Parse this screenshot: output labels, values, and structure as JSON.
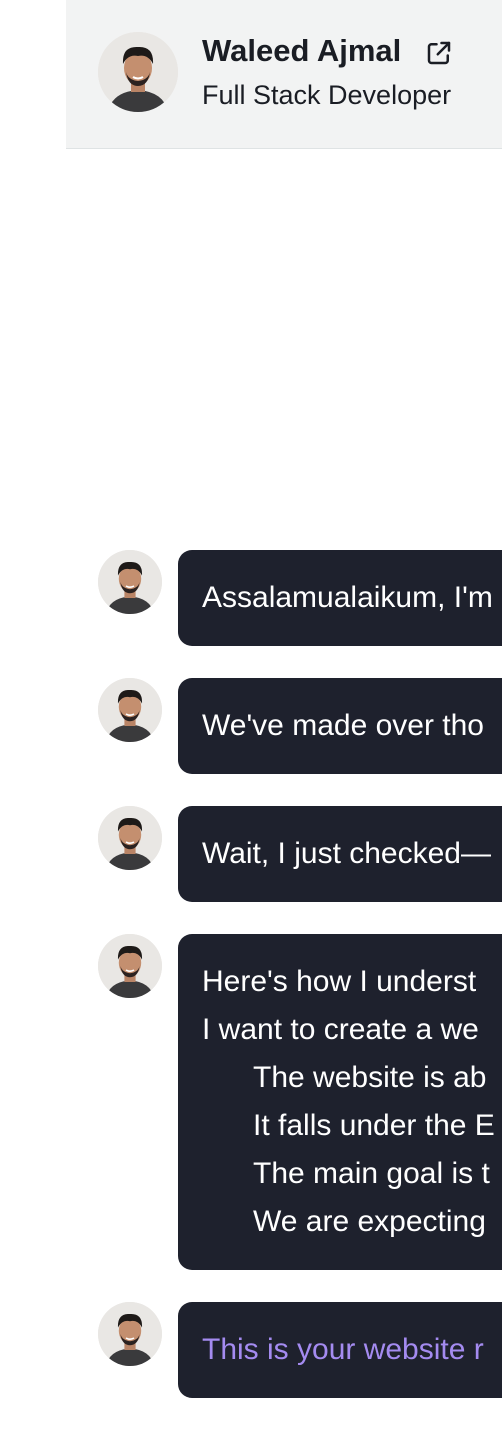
{
  "header": {
    "name": "Waleed Ajmal",
    "role": "Full Stack Developer"
  },
  "messages": [
    {
      "lines": [
        "Assalamualaikum, I'm"
      ]
    },
    {
      "lines": [
        "We've made over tho"
      ]
    },
    {
      "lines": [
        "Wait, I just checked—"
      ]
    },
    {
      "lines": [
        "Here's how I underst",
        "I want to create a we"
      ],
      "bullets": [
        "The website is ab",
        "It falls under the E",
        "The main goal is t",
        "We are expecting"
      ]
    },
    {
      "link_text": "This is your website r"
    }
  ]
}
